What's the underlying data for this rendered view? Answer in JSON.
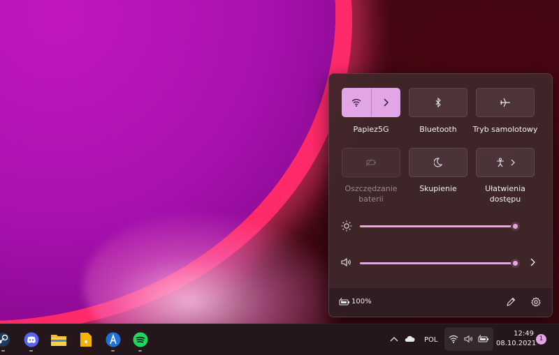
{
  "quick_settings": {
    "tiles": [
      {
        "label": "Papiez5G",
        "icon": "wifi-icon",
        "state": "on"
      },
      {
        "label": "Bluetooth",
        "icon": "bluetooth-icon",
        "state": "off"
      },
      {
        "label": "Tryb samolotowy",
        "icon": "airplane-icon",
        "state": "off"
      },
      {
        "label_line1": "Oszczędzanie",
        "label_line2": "baterii",
        "icon": "battery-saver-icon",
        "state": "disabled"
      },
      {
        "label": "Skupienie",
        "icon": "moon-icon",
        "state": "off"
      },
      {
        "label_line1": "Ułatwienia",
        "label_line2": "dostępu",
        "icon": "accessibility-icon",
        "state": "off"
      }
    ],
    "brightness": {
      "icon": "sun-icon",
      "level_percent": 100
    },
    "volume": {
      "icon": "speaker-icon",
      "level_percent": 100
    },
    "footer": {
      "battery_text": "100%",
      "battery_icon": "battery-charging-icon",
      "edit_icon": "pencil-icon",
      "settings_icon": "gear-icon"
    }
  },
  "taskbar": {
    "apps": [
      "steam-icon",
      "discord-icon",
      "file-explorer-icon",
      "notes-icon",
      "app-icon",
      "spotify-icon"
    ],
    "tray": {
      "language": "POL",
      "time": "12:49",
      "date": "08.10.2021",
      "notification_count": "1"
    }
  },
  "colors": {
    "accent": "#e2a6e6",
    "panel": "#3e262a",
    "taskbar": "#24161a"
  }
}
